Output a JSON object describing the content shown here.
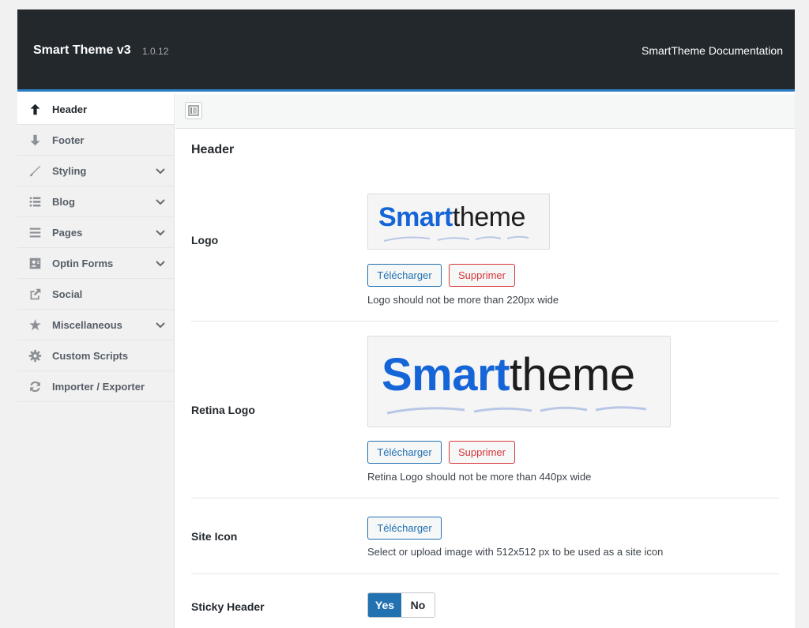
{
  "header": {
    "title": "Smart Theme v3",
    "version": "1.0.12",
    "doc_link": "SmartTheme Documentation"
  },
  "sidebar": {
    "items": [
      {
        "label": "Header",
        "icon": "arrow-up-icon",
        "active": true,
        "expandable": false
      },
      {
        "label": "Footer",
        "icon": "arrow-down-icon",
        "active": false,
        "expandable": false
      },
      {
        "label": "Styling",
        "icon": "brush-icon",
        "active": false,
        "expandable": true
      },
      {
        "label": "Blog",
        "icon": "list-icon",
        "active": false,
        "expandable": true
      },
      {
        "label": "Pages",
        "icon": "menu-lines-icon",
        "active": false,
        "expandable": true
      },
      {
        "label": "Optin Forms",
        "icon": "contact-card-icon",
        "active": false,
        "expandable": true
      },
      {
        "label": "Social",
        "icon": "share-icon",
        "active": false,
        "expandable": false
      },
      {
        "label": "Miscellaneous",
        "icon": "star-icon",
        "active": false,
        "expandable": true
      },
      {
        "label": "Custom Scripts",
        "icon": "gear-icon",
        "active": false,
        "expandable": false
      },
      {
        "label": "Importer / Exporter",
        "icon": "sync-icon",
        "active": false,
        "expandable": false
      }
    ]
  },
  "main": {
    "section_title": "Header",
    "logo": {
      "label": "Logo",
      "brand_part1": "Smart",
      "brand_part2": "theme",
      "upload_label": "Télécharger",
      "remove_label": "Supprimer",
      "description": "Logo should not be more than 220px wide"
    },
    "retina_logo": {
      "label": "Retina Logo",
      "brand_part1": "Smart",
      "brand_part2": "theme",
      "upload_label": "Télécharger",
      "remove_label": "Supprimer",
      "description": "Retina Logo should not be more than 440px wide"
    },
    "site_icon": {
      "label": "Site Icon",
      "upload_label": "Télécharger",
      "description": "Select or upload image with 512x512 px to be used as a site icon"
    },
    "sticky_header": {
      "label": "Sticky Header",
      "yes_label": "Yes",
      "no_label": "No",
      "selected": "Yes"
    }
  },
  "colors": {
    "topbar": "#23282d",
    "accent": "#2271b1",
    "danger": "#d63638",
    "brand_blue": "#1565d8"
  }
}
